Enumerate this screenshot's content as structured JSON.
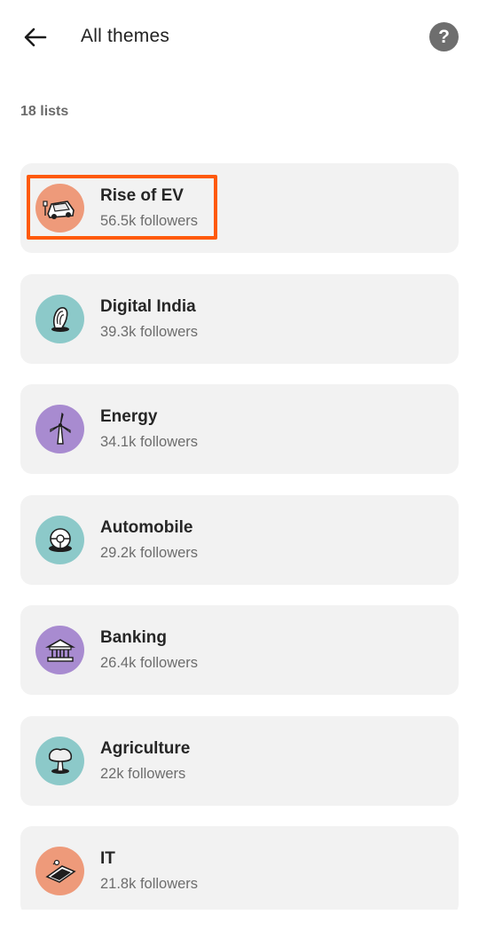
{
  "header": {
    "title": "All themes",
    "back_icon": "arrow-left-icon",
    "help_icon": "question-icon",
    "help_glyph": "?"
  },
  "list_count": "18 lists",
  "colors": {
    "orange": "#ee9a7a",
    "teal": "#8cc9c9",
    "purple": "#a88bd0",
    "highlight": "#ff5a0a"
  },
  "themes": [
    {
      "name": "Rise of EV",
      "followers": "56.5k followers",
      "icon": "electric-car-icon",
      "color": "#ee9a7a"
    },
    {
      "name": "Digital India",
      "followers": "39.3k followers",
      "icon": "fingerprint-icon",
      "color": "#8cc9c9"
    },
    {
      "name": "Energy",
      "followers": "34.1k followers",
      "icon": "wind-turbine-icon",
      "color": "#a88bd0"
    },
    {
      "name": "Automobile",
      "followers": "29.2k followers",
      "icon": "steering-wheel-icon",
      "color": "#8cc9c9"
    },
    {
      "name": "Banking",
      "followers": "26.4k followers",
      "icon": "bank-icon",
      "color": "#a88bd0"
    },
    {
      "name": "Agriculture",
      "followers": "22k followers",
      "icon": "tree-icon",
      "color": "#8cc9c9"
    },
    {
      "name": "IT",
      "followers": "21.8k followers",
      "icon": "laptop-icon",
      "color": "#ee9a7a"
    }
  ]
}
